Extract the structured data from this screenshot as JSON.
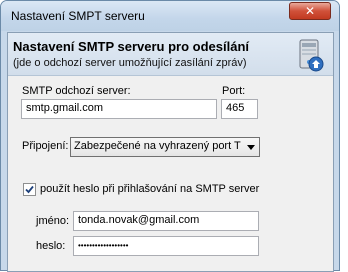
{
  "window": {
    "title": "Nastavení SMPT serveru",
    "close_glyph": "✕"
  },
  "header": {
    "title": "Nastavení SMTP serveru pro odesílání",
    "subtitle": "(jde o odchozí server umožňující zasílání zpráv)",
    "icon": "server-icon"
  },
  "form": {
    "smtp_label": "SMTP odchozí server:",
    "smtp_value": "smtp.gmail.com",
    "port_label": "Port:",
    "port_value": "465",
    "connection_label": "Připojení:",
    "connection_value": "Zabezpečené na vyhrazený port T",
    "auth_checkbox_label": "použít heslo při přihlašování na SMTP server",
    "auth_checked": true,
    "name_label": "jméno:",
    "name_value": "tonda.novak@gmail.com",
    "password_label": "heslo:",
    "password_value": "••••••••••••••••••"
  }
}
